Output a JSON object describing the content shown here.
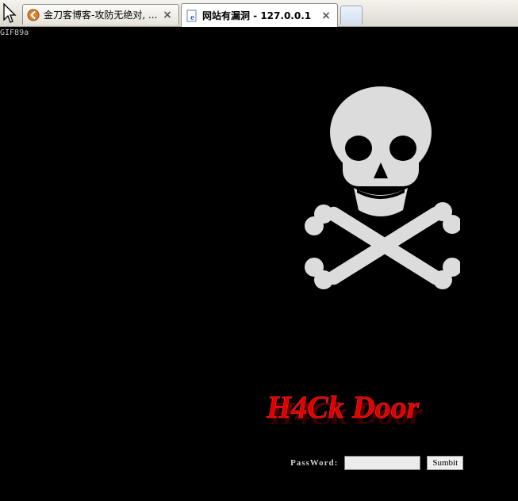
{
  "browser": {
    "tabs": [
      {
        "title": "金刀客博客-攻防无绝对, ...",
        "icon": "back-arrow-icon",
        "active": false
      },
      {
        "title": "网站有漏洞 - 127.0.0.1",
        "icon": "ie-page-icon",
        "active": true
      }
    ],
    "close_glyph": "×"
  },
  "page": {
    "gif_header": "GIF89a",
    "title_text": "H4Ck Door",
    "password_label": "PassWord:",
    "password_value": "",
    "submit_label": "Sumbit",
    "colors": {
      "background": "#000000",
      "skull": "#dcdcdc",
      "title_red": "#e00000"
    }
  }
}
